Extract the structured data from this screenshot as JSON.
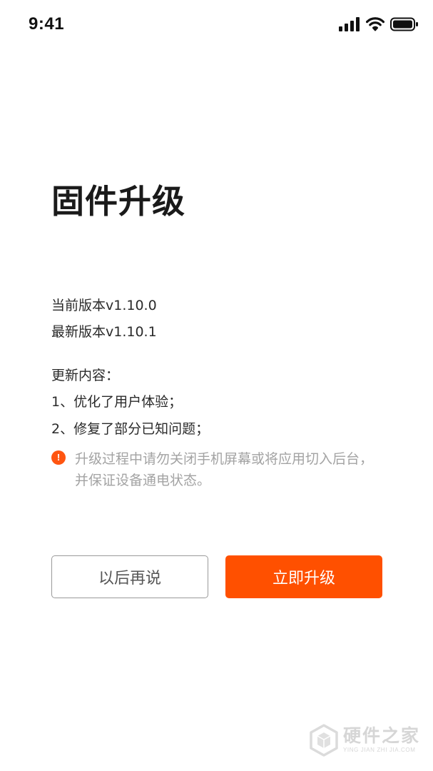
{
  "status_bar": {
    "time": "9:41",
    "icons": [
      "cellular-signal-icon",
      "wifi-icon",
      "battery-icon"
    ]
  },
  "page": {
    "title": "固件升级"
  },
  "version": {
    "current": "当前版本v1.10.0",
    "latest": "最新版本v1.10.1"
  },
  "changelog": {
    "heading": "更新内容：",
    "items": [
      "1、优化了用户体验；",
      "2、修复了部分已知问题；"
    ]
  },
  "notice": {
    "icon": "alert-icon",
    "icon_glyph": "!",
    "text": "升级过程中请勿关闭手机屏幕或将应用切入后台，并保证设备通电状态。"
  },
  "actions": {
    "later_label": "以后再说",
    "upgrade_label": "立即升级"
  },
  "watermark": {
    "main": "硬件之家",
    "sub": "YING JIAN ZHI JIA.COM"
  },
  "colors": {
    "accent": "#ff5000",
    "notice_icon": "#ff5511",
    "notice_text": "#a3a3a3"
  }
}
